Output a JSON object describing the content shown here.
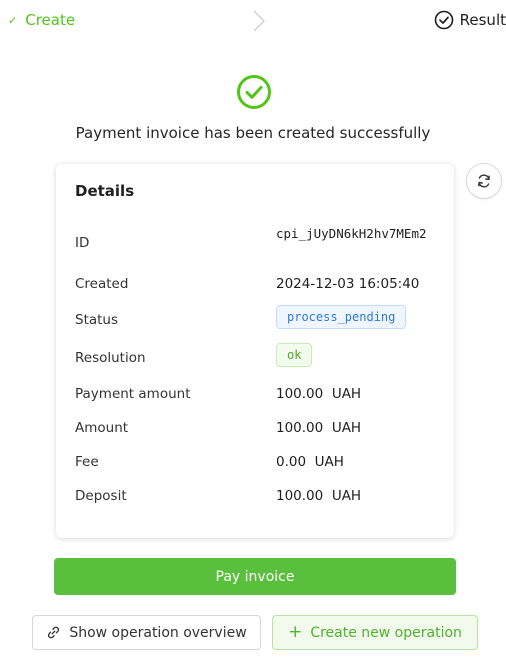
{
  "steps": {
    "create": {
      "label": "Create",
      "status": "done"
    },
    "result": {
      "label": "Result",
      "status": "current"
    }
  },
  "result": {
    "title": "Payment invoice has been created successfully"
  },
  "details": {
    "heading": "Details",
    "rows": {
      "id": {
        "label": "ID",
        "value": "cpi_jUyDN6kH2hv7MEm2"
      },
      "created": {
        "label": "Created",
        "value": "2024-12-03 16:05:40"
      },
      "status": {
        "label": "Status",
        "value": "process_pending"
      },
      "resolution": {
        "label": "Resolution",
        "value": "ok"
      },
      "payment_amount": {
        "label": "Payment amount",
        "value": "100.00  UAH"
      },
      "amount": {
        "label": "Amount",
        "value": "100.00  UAH"
      },
      "fee": {
        "label": "Fee",
        "value": "0.00  UAH"
      },
      "deposit": {
        "label": "Deposit",
        "value": "100.00  UAH"
      }
    }
  },
  "actions": {
    "pay": "Pay invoice",
    "overview": "Show operation overview",
    "create_new": "Create new operation"
  },
  "colors": {
    "accent": "#5abf3c",
    "success": "#52c41a",
    "tag_blue": "#2f7ad8"
  },
  "icons": {
    "create_step": "check-icon",
    "separator": "chevron-right-icon",
    "result_step": "check-circle-icon",
    "success": "check-circle-icon",
    "refresh": "refresh-icon",
    "overview": "link-icon",
    "create_new": "plus-icon"
  }
}
